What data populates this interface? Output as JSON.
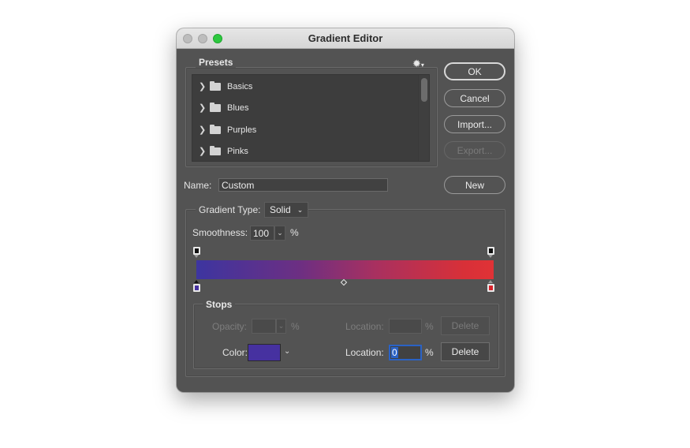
{
  "window": {
    "title": "Gradient Editor",
    "traffic_lights": [
      "close",
      "minimize",
      "zoom"
    ]
  },
  "presets": {
    "title": "Presets",
    "menu_icon": "gear-icon",
    "items": [
      {
        "label": "Basics",
        "icon": "folder-icon"
      },
      {
        "label": "Blues",
        "icon": "folder-icon"
      },
      {
        "label": "Purples",
        "icon": "folder-icon"
      },
      {
        "label": "Pinks",
        "icon": "folder-icon"
      }
    ]
  },
  "buttons": {
    "ok": "OK",
    "cancel": "Cancel",
    "import": "Import...",
    "export": "Export...",
    "new": "New"
  },
  "name": {
    "label": "Name:",
    "value": "Custom"
  },
  "gradient_type": {
    "label": "Gradient Type:",
    "value": "Solid"
  },
  "smoothness": {
    "label": "Smoothness:",
    "value": "100",
    "unit": "%"
  },
  "gradient": {
    "start_color": "#3d35a0",
    "end_color": "#e03236",
    "opacity_stops": [
      {
        "location": 0,
        "color": "#000000"
      },
      {
        "location": 100,
        "color": "#000000"
      }
    ],
    "color_stops": [
      {
        "location": 0,
        "color": "#4631a0",
        "selected": true
      },
      {
        "location": 100,
        "color": "#d8222a",
        "selected": false
      }
    ],
    "midpoint": 50
  },
  "stops": {
    "title": "Stops",
    "opacity_label": "Opacity:",
    "opacity_value": "",
    "opacity_unit": "%",
    "opacity_location_label": "Location:",
    "opacity_location_value": "",
    "opacity_location_unit": "%",
    "opacity_delete": "Delete",
    "color_label": "Color:",
    "color_value": "#4631a0",
    "color_location_label": "Location:",
    "color_location_value": "0",
    "color_location_unit": "%",
    "color_delete": "Delete"
  }
}
